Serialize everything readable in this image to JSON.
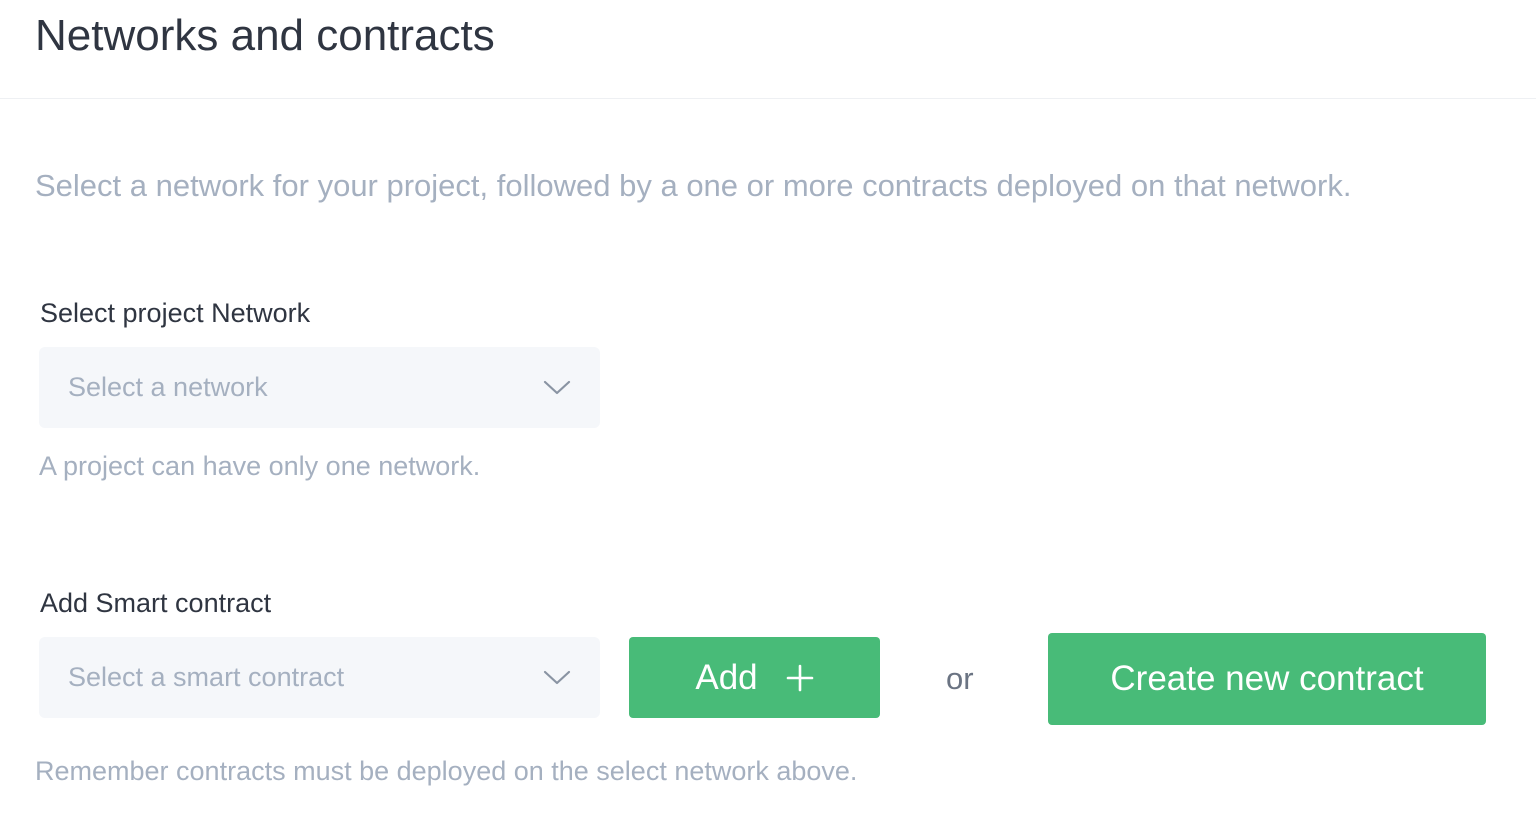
{
  "header": {
    "title": "Networks and contracts"
  },
  "intro": {
    "text": "Select a network for your project, followed by a one or more contracts deployed on that network."
  },
  "network": {
    "label": "Select project Network",
    "placeholder": "Select a network",
    "helper": "A project can have only one network."
  },
  "contract": {
    "label": "Add Smart contract",
    "placeholder": "Select a smart contract",
    "add_label": "Add",
    "or_label": "or",
    "create_label": "Create new contract",
    "helper": "Remember contracts must be deployed on the select network above."
  },
  "icons": {
    "dropdown": "chevron-down-icon",
    "add": "plus-icon"
  },
  "colors": {
    "primary_button": "#48bb78",
    "title_text": "#2f3541",
    "muted_text": "#a5b0c0",
    "select_bg": "#f5f7fa"
  }
}
